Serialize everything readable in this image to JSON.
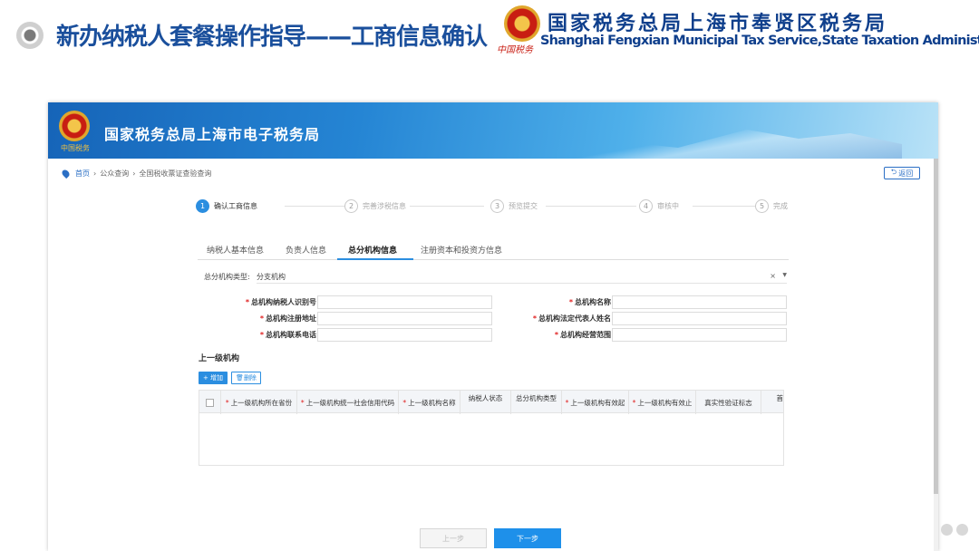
{
  "slide": {
    "title": "新办纳税人套餐操作指导——工商信息确认",
    "brand_cn": "国家税务总局上海市奉贤区税务局",
    "brand_en": "Shanghai Fengxian Municipal Tax Service,State Taxation Administration",
    "brand_signature": "中国税务"
  },
  "app": {
    "banner_title": "国家税务总局上海市电子税务局",
    "banner_signature": "中国税务",
    "breadcrumb": [
      "首页",
      "公众查询",
      "全国税收票证查验查询"
    ],
    "back_label": "返回"
  },
  "steps": [
    {
      "num": "1",
      "label": "确认工商信息"
    },
    {
      "num": "2",
      "label": "完善涉税信息"
    },
    {
      "num": "3",
      "label": "预览提交"
    },
    {
      "num": "4",
      "label": "审核中"
    },
    {
      "num": "5",
      "label": "完成"
    }
  ],
  "tabs": [
    "纳税人基本信息",
    "负责人信息",
    "总分机构信息",
    "注册资本和投资方信息"
  ],
  "form": {
    "type_label": "总分机构类型:",
    "type_value": "分支机构",
    "clear_icon": "×",
    "fields": [
      {
        "label": "总机构纳税人识别号",
        "required": "*"
      },
      {
        "label": "总机构名称",
        "required": "*"
      },
      {
        "label": "总机构注册地址",
        "required": "*"
      },
      {
        "label": "总机构法定代表人姓名",
        "required": "*"
      },
      {
        "label": "总机构联系电话",
        "required": "*"
      },
      {
        "label": "总机构经营范围",
        "required": "*"
      }
    ]
  },
  "parent": {
    "section_title": "上一级机构",
    "add_label": "+ 增加",
    "delete_label": "删除",
    "columns": [
      {
        "label": "上一级机构所在省份",
        "required": "*"
      },
      {
        "label": "上一级机构统一社会信用代码",
        "required": "*"
      },
      {
        "label": "上一级机构名称",
        "required": "*"
      },
      {
        "label": "纳税人状态",
        "required": ""
      },
      {
        "label": "总分机构类型",
        "required": ""
      },
      {
        "label": "上一级机构有效起",
        "required": "*"
      },
      {
        "label": "上一级机构有效止",
        "required": "*"
      },
      {
        "label": "真实性验证标志",
        "required": ""
      },
      {
        "label": "首",
        "required": ""
      }
    ]
  },
  "nav": {
    "prev_label": "上一步",
    "next_label": "下一步"
  },
  "colors": {
    "brand_blue": "#1a4f9c",
    "accent": "#2b8ee0",
    "required": "#e02020"
  }
}
